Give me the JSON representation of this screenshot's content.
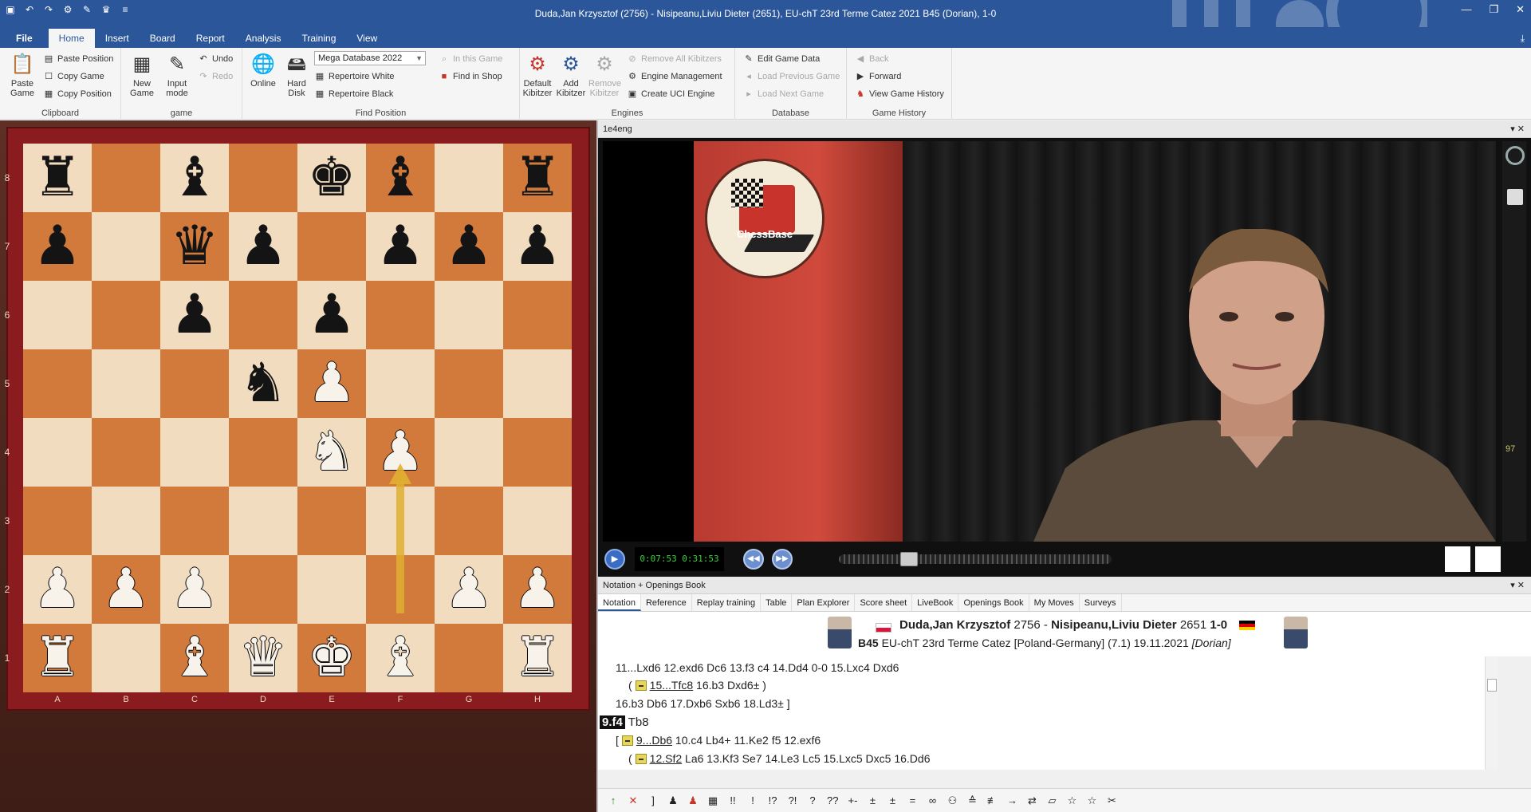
{
  "window": {
    "title": "Duda,Jan Krzysztof (2756) - Nisipeanu,Liviu Dieter (2651), EU-chT 23rd Terme Catez 2021  B45  (Dorian), 1-0"
  },
  "tabs": [
    "Home",
    "Insert",
    "Board",
    "Report",
    "Analysis",
    "Training",
    "View"
  ],
  "file_tab": "File",
  "ribbon": {
    "clipboard": {
      "label": "Clipboard",
      "paste_game": "Paste Game",
      "paste_position": "Paste Position",
      "copy_game": "Copy Game",
      "copy_position": "Copy Position"
    },
    "game": {
      "label": "game",
      "new_game": "New Game",
      "input_mode": "Input mode",
      "undo": "Undo",
      "redo": "Redo"
    },
    "find_position": {
      "label": "Find Position",
      "online": "Online",
      "hard_disk": "Hard Disk",
      "database_combo": "Mega Database 2022",
      "in_this_game": "In this Game",
      "repertoire_white": "Repertoire White",
      "repertoire_black": "Repertoire Black",
      "find_in_shop": "Find in Shop"
    },
    "engines": {
      "label": "Engines",
      "default_kibitzer": "Default Kibitzer",
      "add_kibitzer": "Add Kibitzer",
      "remove_kibitzer": "Remove Kibitzer",
      "remove_all_kibitzers": "Remove All Kibitzers",
      "engine_management": "Engine Management",
      "create_uci_engine": "Create UCI Engine"
    },
    "database": {
      "label": "Database",
      "edit_game_data": "Edit Game Data",
      "load_previous_game": "Load Previous Game",
      "load_next_game": "Load Next Game"
    },
    "game_history": {
      "label": "Game History",
      "back": "Back",
      "forward": "Forward",
      "view_game_history": "View Game History"
    }
  },
  "board": {
    "ranks": [
      "8",
      "7",
      "6",
      "5",
      "4",
      "3",
      "2",
      "1"
    ],
    "files": [
      "A",
      "B",
      "C",
      "D",
      "E",
      "F",
      "G",
      "H"
    ],
    "position": [
      [
        "br",
        "",
        "bb",
        "",
        "bk",
        "bb",
        "",
        "br"
      ],
      [
        "bp",
        "",
        "bq",
        "bp",
        "",
        "bp",
        "bp",
        "bp"
      ],
      [
        "",
        "",
        "bp",
        "",
        "bp",
        "",
        "",
        ""
      ],
      [
        "",
        "",
        "",
        "bn",
        "wp",
        "",
        "",
        ""
      ],
      [
        "",
        "",
        "",
        "",
        "wn",
        "wp",
        "",
        ""
      ],
      [
        "",
        "",
        "",
        "",
        "",
        "",
        "",
        ""
      ],
      [
        "wp",
        "wp",
        "wp",
        "",
        "",
        "",
        "wp",
        "wp"
      ],
      [
        "wr",
        "",
        "wb",
        "wq",
        "wk",
        "wb",
        "",
        "wr"
      ]
    ],
    "last_move_arrow": {
      "from": "f2",
      "to": "f4",
      "color": "#e0b030"
    }
  },
  "video": {
    "pane_title": "1e4eng",
    "logo_text": "ChessBase",
    "timecode": "0:07:53 0:31:53",
    "progress_fraction": 0.24,
    "volume_value": "97"
  },
  "notation_pane": {
    "title": "Notation + Openings Book",
    "tabs": [
      "Notation",
      "Reference",
      "Replay training",
      "Table",
      "Plan Explorer",
      "Score sheet",
      "LiveBook",
      "Openings Book",
      "My Moves",
      "Surveys"
    ],
    "active_tab": "Notation",
    "white": "Duda,Jan Krzysztof",
    "white_rating": "2756",
    "sep": "-",
    "black": "Nisipeanu,Liviu Dieter",
    "black_rating": "2651",
    "result": "1-0",
    "eco": "B45",
    "event": "EU-chT 23rd Terme Catez [Poland-Germany] (7.1) 19.11.2021",
    "annotator": "[Dorian]",
    "lines": {
      "l1": "11...Lxd6  12.exd6  Dc6  13.f3  c4  14.Dd4  0-0  15.Lxc4  Dxd6",
      "l2_open": "(",
      "l2_move": "15...Tfc8",
      "l2_rest": "16.b3  Dxd6± )",
      "l3": "16.b3  Db6  17.Dxb6  Sxb6  18.Ld3± ]",
      "l4_move": "9.f4",
      "l4_rest": "Tb8",
      "l5_open": "[",
      "l5_move": "9...Db6",
      "l5_rest": "10.c4  Lb4+  11.Ke2  f5  12.exf6",
      "l6_open": "(",
      "l6_move": "12.Sf2",
      "l6_rest": "La6  13.Kf3  Se7  14.Le3  Lc5  15.Lxc5  Dxc5  16.Dd6"
    }
  },
  "symbols": [
    "↑",
    "✕",
    "]",
    "♟",
    "♟",
    "▦",
    "!!",
    "!",
    "!?",
    "?!",
    "?",
    "??",
    "+-",
    "±",
    "±",
    "=",
    "∞",
    "⚇",
    "≙",
    "≢",
    "→",
    "⇄",
    "▱",
    "☆",
    "☆",
    "✂"
  ],
  "colors": {
    "title_bar": "#2b579a",
    "light_square": "#f2dcc0",
    "dark_square": "#d27a3c",
    "board_frame": "#8a1c1f",
    "timecode_green": "#39d13b"
  }
}
